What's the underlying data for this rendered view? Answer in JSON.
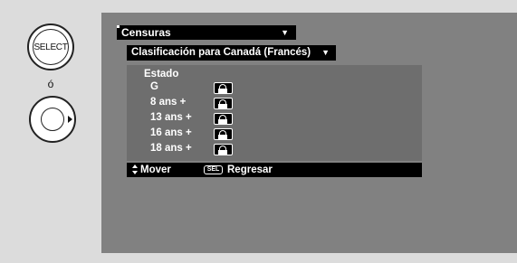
{
  "remote": {
    "select_label": "SELECT",
    "or_label": "ó"
  },
  "menu": {
    "title": "Censuras",
    "submenu": "Clasificación para Canadá (Francés)"
  },
  "panel": {
    "heading": "Estado",
    "ratings": [
      {
        "label": "G",
        "icon": "lock-icon"
      },
      {
        "label": "8 ans +",
        "icon": "lock-icon"
      },
      {
        "label": "13 ans +",
        "icon": "lock-icon"
      },
      {
        "label": "16 ans +",
        "icon": "lock-icon"
      },
      {
        "label": "18 ans +",
        "icon": "lock-icon"
      }
    ]
  },
  "help": {
    "move": "Mover",
    "sel_key": "SEL",
    "back": "Regresar"
  },
  "colors": {
    "page_bg": "#dcdcdc",
    "screen_bg": "#818181",
    "panel_bg": "#6e6e6e",
    "bar_bg": "#000000",
    "text": "#ffffff"
  }
}
